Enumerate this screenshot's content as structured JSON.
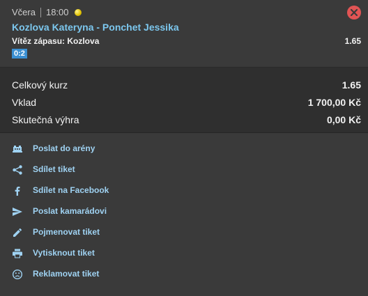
{
  "bet": {
    "day": "Včera",
    "time": "18:00",
    "match": "Kozlova Kateryna - Ponchet Jessika",
    "market": "Vítěz zápasu: Kozlova",
    "odd": "1.65",
    "score": "0:2"
  },
  "summary": {
    "total_odds_label": "Celkový kurz",
    "total_odds_value": "1.65",
    "stake_label": "Vklad",
    "stake_value": "1 700,00 Kč",
    "win_label": "Skutečná výhra",
    "win_value": "0,00 Kč"
  },
  "actions": [
    {
      "label": "Poslat do arény",
      "icon": "arena-icon"
    },
    {
      "label": "Sdílet tiket",
      "icon": "share-icon"
    },
    {
      "label": "Sdílet na Facebook",
      "icon": "facebook-icon"
    },
    {
      "label": "Poslat kamarádovi",
      "icon": "send-icon"
    },
    {
      "label": "Pojmenovat tiket",
      "icon": "pencil-icon"
    },
    {
      "label": "Vytisknout tiket",
      "icon": "print-icon"
    },
    {
      "label": "Reklamovat tiket",
      "icon": "sad-face-icon"
    }
  ],
  "colors": {
    "accent": "#7cc7ee",
    "lost": "#e15454",
    "score_badge": "#3b8fd1",
    "tennis_ball": "#e0c100"
  }
}
